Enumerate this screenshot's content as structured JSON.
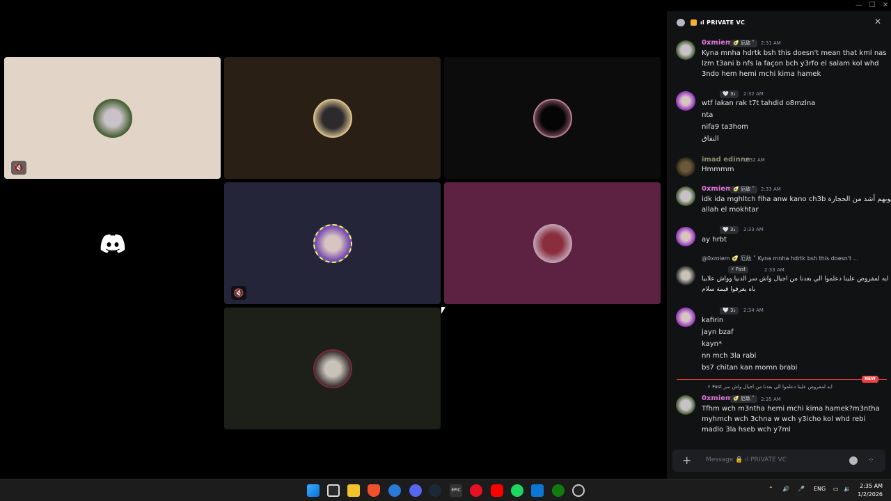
{
  "window": {
    "min": "—",
    "max": "☐",
    "close": "✕"
  },
  "channel": {
    "name": "ıl PRIVATE VC"
  },
  "tiles": [
    {
      "bg": "#e2d5c8",
      "muted": true
    },
    {
      "bg": "#2a1f15",
      "muted": false
    },
    {
      "bg": "#0c0c0c",
      "muted": false
    },
    {
      "bg": "#000000",
      "discord": true
    },
    {
      "bg": "#25253a",
      "muted": true
    },
    {
      "bg": "#5d2141",
      "muted": false
    },
    {
      "bg": "#1c2019",
      "muted": false
    }
  ],
  "messages": [
    {
      "name": "0xmiem",
      "tag": "🥑 厄敌 ˚",
      "time": "2:31 AM",
      "lines": [
        "Kyna mnha hdrtk bsh this doesn't mean that kml nas",
        "lzm t3ani b nfs la façon bch y3rfo el salam kol whd",
        "3ndo hem hemi mchi kima hamek"
      ]
    },
    {
      "name": "",
      "tag": "🤍 ذ3",
      "time": "2:32 AM",
      "lines": [
        "wtf lakan rak t7t tahdid o8mzlna",
        "nta",
        "nifa9 ta3hom",
        "النفاق"
      ]
    },
    {
      "name": "imad edinne",
      "tag": "",
      "time": "2:32 AM",
      "lines": [
        "Hmmmm"
      ]
    },
    {
      "name": "0xmiem",
      "tag": "🥑 厄敌 ˚",
      "time": "2:33 AM",
      "lines": [
        "idk ida mghltch fiha anw kano ch3b  قلوبهم أشد من الحجارة",
        "allah el mokhtar"
      ]
    },
    {
      "name": "",
      "tag": "🤍 ذ3",
      "time": "2:33 AM",
      "lines": [
        "ay hrbt"
      ]
    },
    {
      "reply": "@0xmiem  🥑 厄敌 ˚  Kyna mnha hdrtk bsh this doesn't ...",
      "name": "",
      "tag": "⚡ Fast",
      "time": "2:33 AM",
      "lines": [
        "ايه لمفروض علينا دعلموا الي بعدنا من اجيال واش سر الدنيا وواش علابيا",
        "باه يعرفوا قيمة سلام"
      ]
    },
    {
      "name": "",
      "tag": "🤍 ذ3",
      "time": "2:34 AM",
      "lines": [
        "kafirin",
        "jayn bzaf",
        "kayn*",
        "nn mch 3la rabi",
        "bs7 chitan kan momn brabi"
      ]
    },
    {
      "reply": "⚡ Fast  ايه لمفروض علينا دعلموا الي بعدنا من اجيال واش سر",
      "name": "0xmiem",
      "tag": "🥑 厄敌 ˚",
      "time": "2:35 AM",
      "lines": [
        "Tfhm wch m3ntha hemi mchi kima hamek?m3ntha",
        "myhmch wch 3chna w wch y3icho kol whd rebi",
        "madlo 3la hseb wch y7ml"
      ]
    }
  ],
  "new_badge": "NEW",
  "composer": {
    "placeholder": "Message  🔒  ıl PRIVATE VC"
  },
  "taskbar": {
    "lang": "ENG",
    "time": "2:35 AM",
    "date": "1/2/2026"
  }
}
